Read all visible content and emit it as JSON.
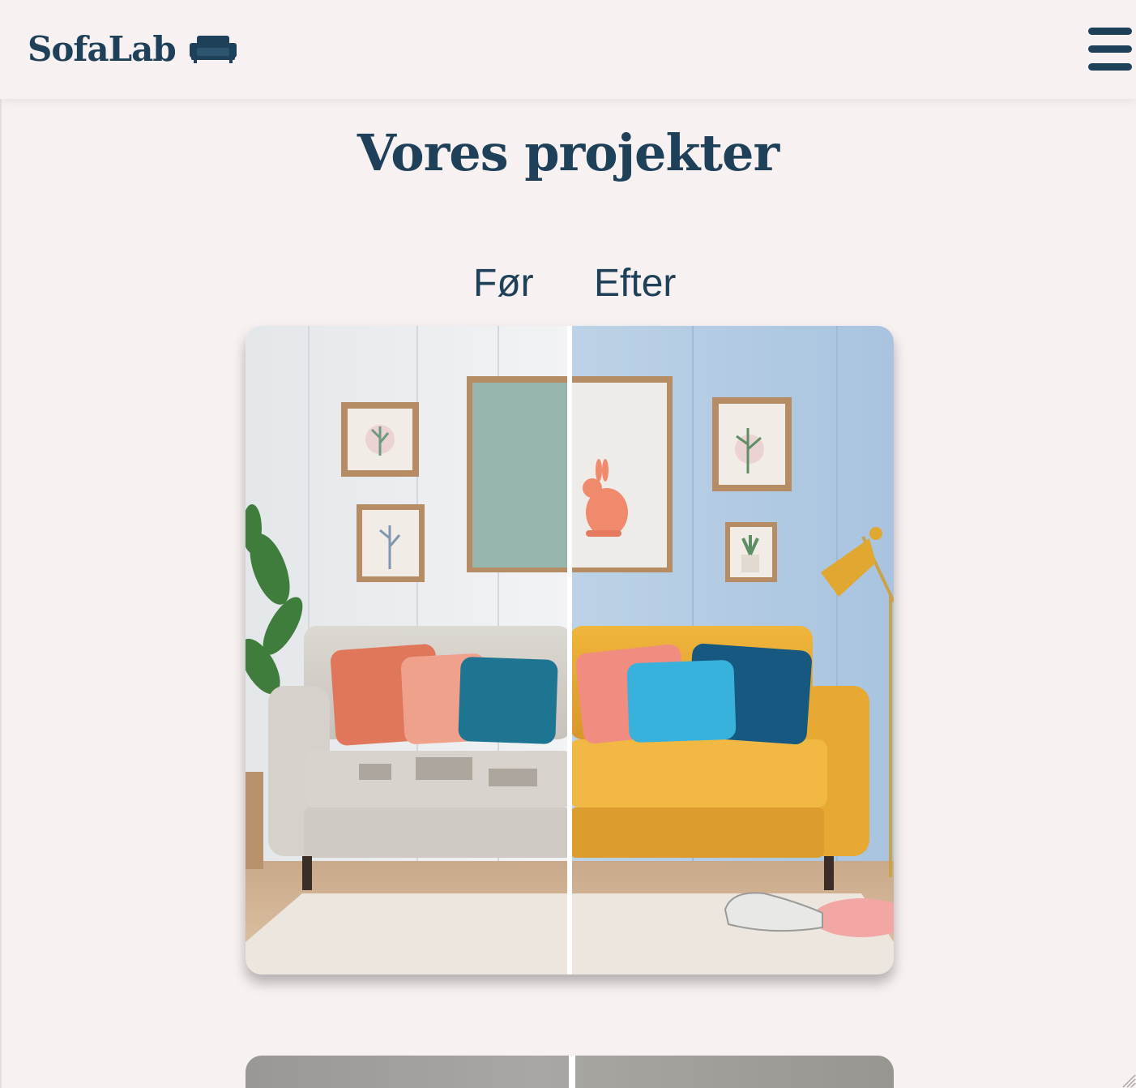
{
  "header": {
    "brand_name": "SofaLab",
    "brand_icon": "sofa-icon",
    "menu_icon": "hamburger-menu-icon"
  },
  "main": {
    "title": "Vores projekter",
    "projects": [
      {
        "before_label": "Før",
        "after_label": "Efter",
        "image": "before-after-sofa-reupholstery-comparison"
      },
      {
        "image": "before-after-comparison-partially-visible"
      }
    ]
  },
  "colors": {
    "primary": "#1f4059",
    "background": "#f7f1f1",
    "divider": "#ffffff"
  }
}
